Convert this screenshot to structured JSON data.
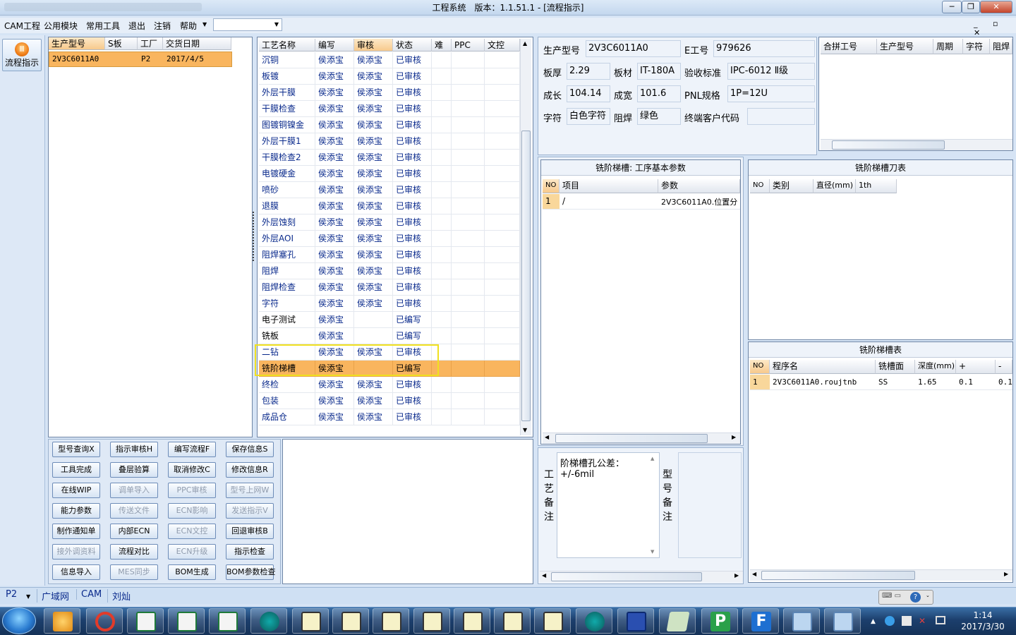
{
  "window": {
    "title": "工程系统　版本：1.1.51.1 - [流程指示]"
  },
  "menu": {
    "items": [
      "CAM工程",
      "公用模块",
      "常用工具",
      "退出",
      "注销",
      "帮助"
    ]
  },
  "flow_button": {
    "label": "流程指示"
  },
  "models": {
    "headers": [
      "生产型号",
      "S板",
      "工厂",
      "交货日期"
    ],
    "rows": [
      {
        "model": "2V3C6011A0",
        "s": "",
        "factory": "P2",
        "date": "2017/4/5"
      }
    ]
  },
  "process": {
    "headers": [
      "工艺名称",
      "编写",
      "审核",
      "状态",
      "难",
      "PPC",
      "文控"
    ],
    "rows": [
      [
        "沉铜",
        "侯添宝",
        "侯添宝",
        "已审核"
      ],
      [
        "板镀",
        "侯添宝",
        "侯添宝",
        "已审核"
      ],
      [
        "外层干膜",
        "侯添宝",
        "侯添宝",
        "已审核"
      ],
      [
        "干膜检查",
        "侯添宝",
        "侯添宝",
        "已审核"
      ],
      [
        "图镀铜镍金",
        "侯添宝",
        "侯添宝",
        "已审核"
      ],
      [
        "外层干膜1",
        "侯添宝",
        "侯添宝",
        "已审核"
      ],
      [
        "干膜检查2",
        "侯添宝",
        "侯添宝",
        "已审核"
      ],
      [
        "电镀硬金",
        "侯添宝",
        "侯添宝",
        "已审核"
      ],
      [
        "喷砂",
        "侯添宝",
        "侯添宝",
        "已审核"
      ],
      [
        "退膜",
        "侯添宝",
        "侯添宝",
        "已审核"
      ],
      [
        "外层蚀刻",
        "侯添宝",
        "侯添宝",
        "已审核"
      ],
      [
        "外层AOI",
        "侯添宝",
        "侯添宝",
        "已审核"
      ],
      [
        "阻焊塞孔",
        "侯添宝",
        "侯添宝",
        "已审核"
      ],
      [
        "阻焊",
        "侯添宝",
        "侯添宝",
        "已审核"
      ],
      [
        "阻焊检查",
        "侯添宝",
        "侯添宝",
        "已审核"
      ],
      [
        "字符",
        "侯添宝",
        "侯添宝",
        "已审核"
      ],
      [
        "电子测试",
        "侯添宝",
        "",
        "已编写"
      ],
      [
        "铣板",
        "侯添宝",
        "",
        "已编写"
      ],
      [
        "二钻",
        "侯添宝",
        "侯添宝",
        "已审核"
      ],
      [
        "铣阶梯槽",
        "侯添宝",
        "",
        "已编写"
      ],
      [
        "终检",
        "侯添宝",
        "侯添宝",
        "已审核"
      ],
      [
        "包装",
        "侯添宝",
        "侯添宝",
        "已审核"
      ],
      [
        "成品仓",
        "侯添宝",
        "侯添宝",
        "已审核"
      ]
    ]
  },
  "info": {
    "model_label": "生产型号",
    "model_value": "2V3C6011A0",
    "e_label": "E工号",
    "e_value": "979626",
    "thick_label": "板厚",
    "thick_value": "2.29",
    "material_label": "板材",
    "material_value": "IT-180A",
    "std_label": "验收标准",
    "std_value": "IPC-6012 Ⅱ级",
    "len_label": "成长",
    "len_value": "104.14",
    "wid_label": "成宽",
    "wid_value": "101.6",
    "pnl_label": "PNL规格",
    "pnl_value": "1P=12U",
    "char_label": "字符",
    "char_value": "白色字符",
    "mask_label": "阻焊",
    "mask_value": "绿色",
    "cust_label": "终端客户代码",
    "cust_value": ""
  },
  "merge": {
    "headers": [
      "合拼工号",
      "生产型号",
      "周期",
      "字符",
      "阻焊"
    ]
  },
  "params": {
    "title": "铣阶梯槽: 工序基本参数",
    "headers": [
      "NO",
      "项目",
      "参数"
    ],
    "rows": [
      [
        "1",
        "/",
        "2V3C6011A0.位置分"
      ]
    ]
  },
  "tools": {
    "title": "铣阶梯槽刀表",
    "headers": [
      "NO",
      "类别",
      "直径(mm)",
      "1th"
    ]
  },
  "slots": {
    "title": "铣阶梯槽表",
    "headers": [
      "NO",
      "程序名",
      "铣槽面",
      "深度(mm)",
      "+",
      "-"
    ],
    "rows": [
      [
        "1",
        "2V3C6011A0.roujtnb",
        "SS",
        "1.65",
        "0.1",
        "0.1"
      ]
    ]
  },
  "remarks": {
    "process_label": "工艺备注",
    "process_text_1": "阶梯槽孔公差：",
    "process_text_2": "+/-6mil",
    "model_label": "型号备注"
  },
  "buttons": [
    {
      "label": "型号查询X",
      "enabled": true
    },
    {
      "label": "指示审核H",
      "enabled": true
    },
    {
      "label": "编写流程F",
      "enabled": true
    },
    {
      "label": "保存信息S",
      "enabled": true
    },
    {
      "label": "工具完成",
      "enabled": true
    },
    {
      "label": "叠层验算",
      "enabled": true
    },
    {
      "label": "取消修改C",
      "enabled": true
    },
    {
      "label": "修改信息R",
      "enabled": true
    },
    {
      "label": "在线WIP",
      "enabled": true
    },
    {
      "label": "调单导入",
      "enabled": false
    },
    {
      "label": "PPC审核",
      "enabled": false
    },
    {
      "label": "型号上网W",
      "enabled": false
    },
    {
      "label": "能力参数",
      "enabled": true
    },
    {
      "label": "传送文件",
      "enabled": false
    },
    {
      "label": "ECN影响",
      "enabled": false
    },
    {
      "label": "发送指示V",
      "enabled": false
    },
    {
      "label": "制作通知单",
      "enabled": true
    },
    {
      "label": "内部ECN",
      "enabled": true
    },
    {
      "label": "ECN文控",
      "enabled": false
    },
    {
      "label": "回退审核B",
      "enabled": true
    },
    {
      "label": "接外调资料",
      "enabled": false
    },
    {
      "label": "流程对比",
      "enabled": true
    },
    {
      "label": "ECN升级",
      "enabled": false
    },
    {
      "label": "指示检查",
      "enabled": true
    },
    {
      "label": "信息导入",
      "enabled": true
    },
    {
      "label": "MES同步",
      "enabled": false
    },
    {
      "label": "BOM生成",
      "enabled": true
    },
    {
      "label": "BOM参数检查",
      "enabled": true
    }
  ],
  "status": {
    "factory": "P2",
    "network": "广域网",
    "module": "CAM",
    "user": "刘灿"
  },
  "clock": {
    "time": "1:14",
    "date": "2017/3/30"
  },
  "colors": {
    "selected_row": "#f9b55e",
    "highlight_border": "#f0e020",
    "link_text": "#0a2a8c"
  }
}
